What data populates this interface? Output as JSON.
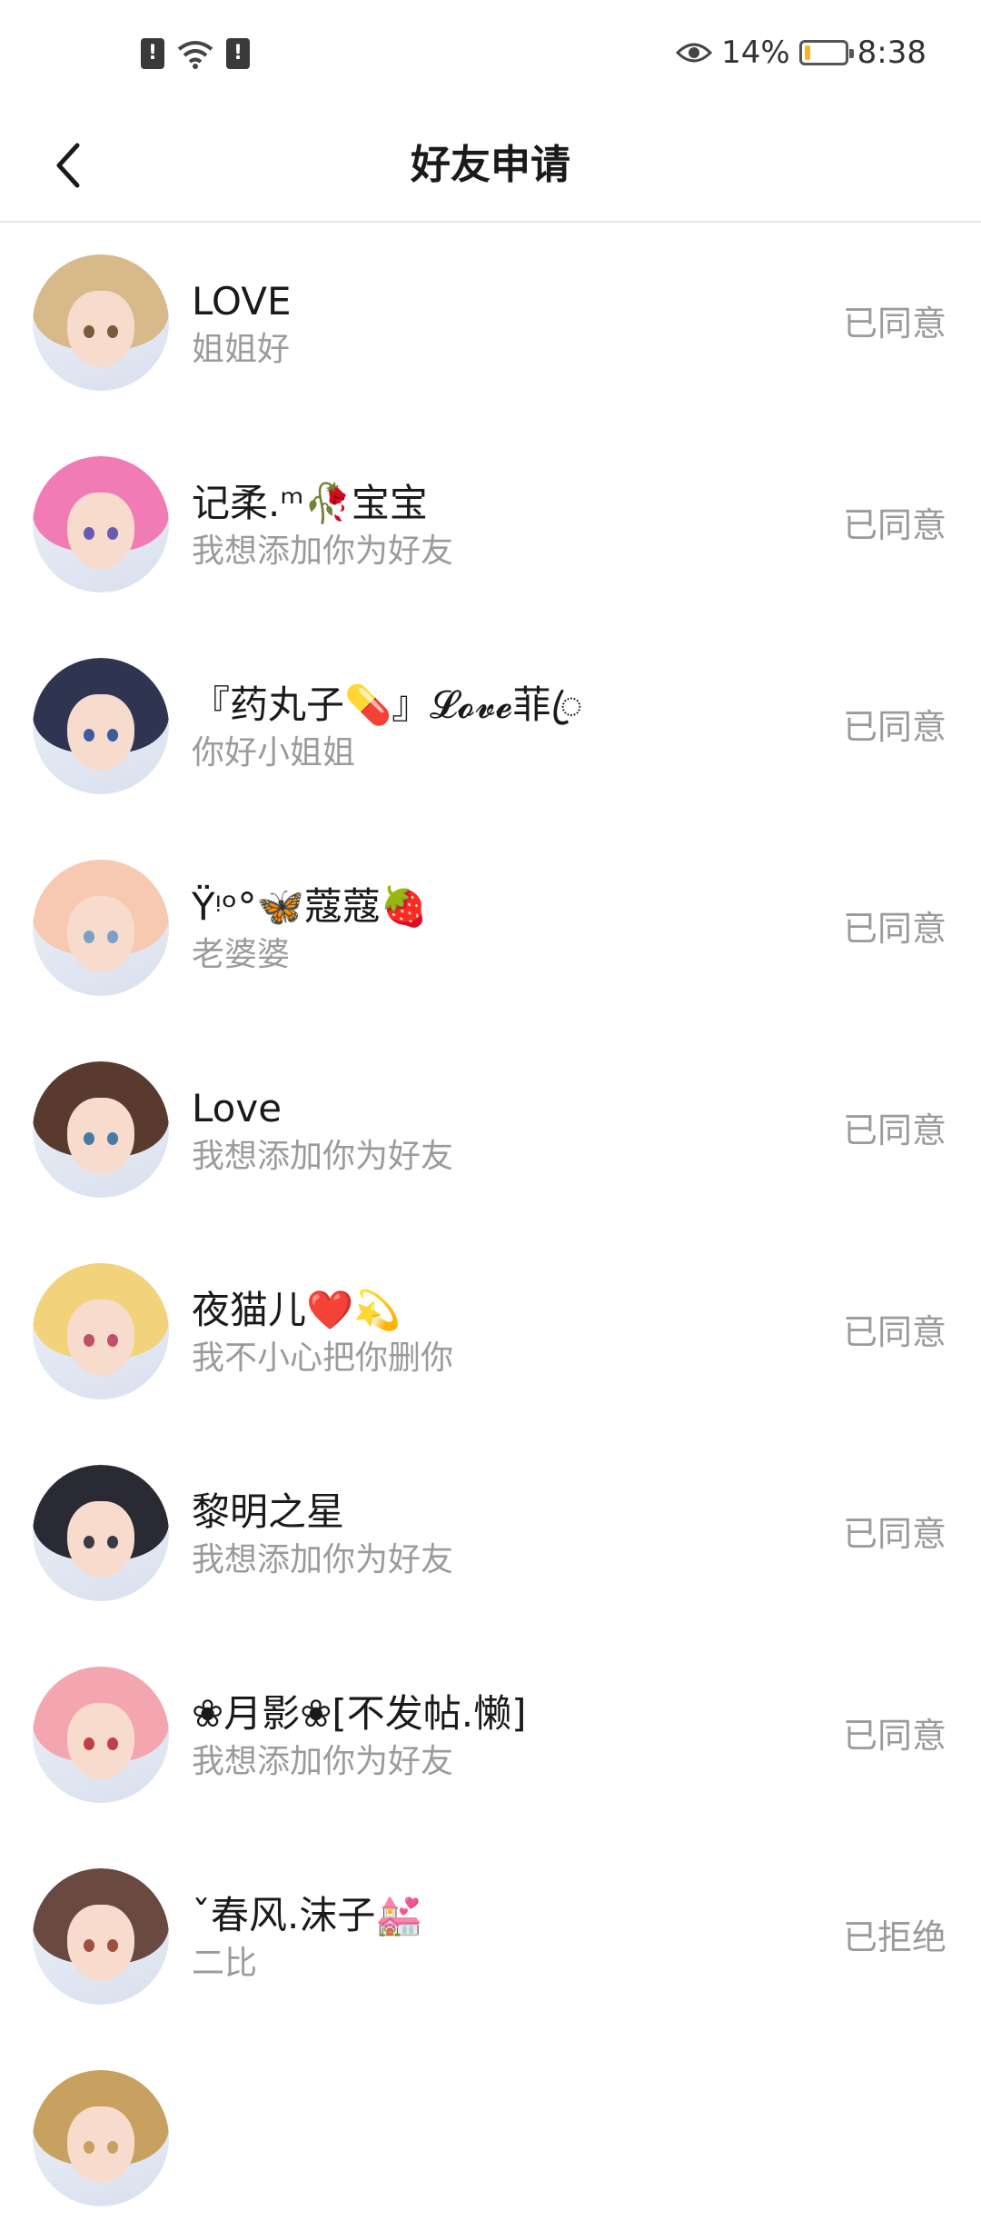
{
  "status_bar": {
    "eye_icon": "eye-icon",
    "battery_percent": "14%",
    "battery_level": 0.14,
    "time": "8:38"
  },
  "header": {
    "title": "好友申请",
    "back_icon": "chevron-left-icon"
  },
  "requests": [
    {
      "name": "LOVE",
      "message": "姐姐好",
      "status": "已同意",
      "hair": "#d8b98a",
      "eye": "#7a5a3a"
    },
    {
      "name": "记柔.ᵐ🥀宝宝",
      "message": "我想添加你为好友",
      "status": "已同意",
      "hair": "#f07bb5",
      "eye": "#6a5bb0"
    },
    {
      "name": "『药丸子💊』𝓛𝓸𝓿𝓮菲ꦿ",
      "message": "你好小姐姐",
      "status": "已同意",
      "hair": "#2f3550",
      "eye": "#3d5c9e"
    },
    {
      "name": "Ÿᵎᵒ°🦋蔻蔻🍓",
      "message": "老婆婆",
      "status": "已同意",
      "hair": "#f6c9b0",
      "eye": "#7aa0c8"
    },
    {
      "name": "Love",
      "message": "我想添加你为好友",
      "status": "已同意",
      "hair": "#5a3a2e",
      "eye": "#4a7aa0"
    },
    {
      "name": "夜猫儿❤️💫",
      "message": "我不小心把你删你",
      "status": "已同意",
      "hair": "#f2d27a",
      "eye": "#c0506a"
    },
    {
      "name": "黎明之星",
      "message": "我想添加你为好友",
      "status": "已同意",
      "hair": "#2a2a34",
      "eye": "#3a3a44"
    },
    {
      "name": "❀月影❀[不发帖.懒]",
      "message": "我想添加你为好友",
      "status": "已同意",
      "hair": "#f4a6b0",
      "eye": "#c0404a"
    },
    {
      "name": "ˇ春风.沫子💒",
      "message": "二比",
      "status": "已拒绝",
      "hair": "#6a4a40",
      "eye": "#a05040"
    },
    {
      "name": "",
      "message": "",
      "status": "",
      "hair": "#c8a060",
      "eye": "#c8a060"
    }
  ]
}
